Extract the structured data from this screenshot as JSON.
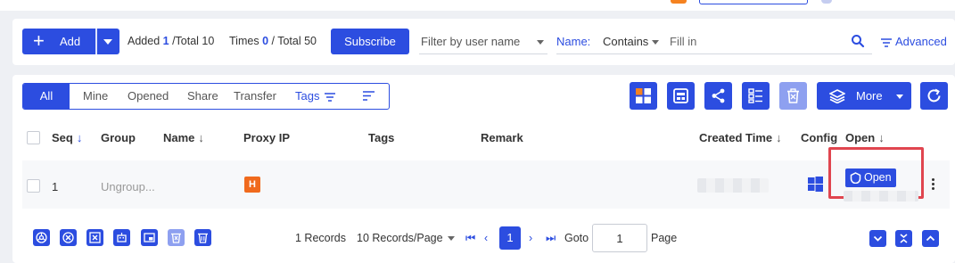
{
  "toolbar": {
    "add_label": "Add",
    "added_prefix": "Added",
    "added_count": "1",
    "added_total": "/Total 10",
    "times_prefix": "Times",
    "times_count": "0",
    "times_total": "/ Total 50",
    "subscribe_label": "Subscribe",
    "filter_user_placeholder": "Filter by user name",
    "name_label": "Name:",
    "contains_label": "Contains",
    "fill_in_placeholder": "Fill in",
    "advanced_label": "Advanced"
  },
  "tabs": [
    {
      "label": "All",
      "active": true
    },
    {
      "label": "Mine"
    },
    {
      "label": "Opened"
    },
    {
      "label": "Share"
    },
    {
      "label": "Transfer"
    },
    {
      "label": "Tags"
    }
  ],
  "actions": {
    "more_label": "More"
  },
  "table": {
    "columns": [
      "Seq",
      "Group",
      "Name",
      "Proxy IP",
      "Tags",
      "Remark",
      "Created Time",
      "Config",
      "Open"
    ],
    "rows": [
      {
        "seq": "1",
        "group": "Ungroup...",
        "name": "",
        "proxy_badge": "H",
        "tags": "",
        "remark": "",
        "config_icon": "windows-icon",
        "open_label": "Open"
      }
    ]
  },
  "footer": {
    "records": "1 Records",
    "per_page": "10 Records/Page",
    "current_page": "1",
    "goto_label": "Goto",
    "goto_value": "1",
    "page_label": "Page"
  },
  "colors": {
    "primary": "#2c4de0",
    "proxy_badge": "#f06a1d",
    "highlight": "#e0454f"
  }
}
